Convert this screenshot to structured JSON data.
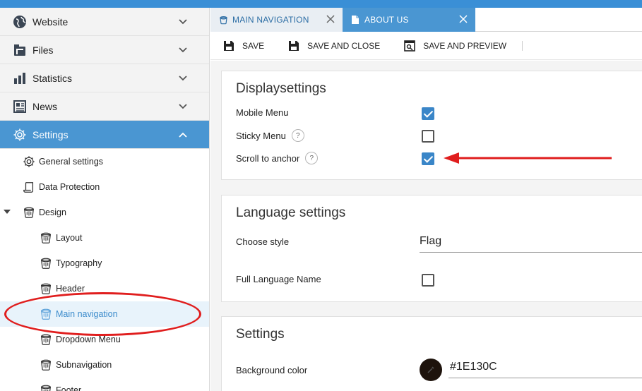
{
  "colors": {
    "accent": "#4a96d2",
    "topbar": "#3a8fd6",
    "checkbox_on": "#3a86c8",
    "annotation": "#e01e1e",
    "background_color_value": "#1e130c"
  },
  "sidebar": {
    "items": [
      {
        "label": "Website",
        "icon": "globe-icon"
      },
      {
        "label": "Files",
        "icon": "files-icon"
      },
      {
        "label": "Statistics",
        "icon": "bar-chart-icon"
      },
      {
        "label": "News",
        "icon": "newspaper-icon"
      },
      {
        "label": "Settings",
        "icon": "gear-icon"
      }
    ],
    "settings_children": [
      {
        "label": "General settings",
        "icon": "gear-icon"
      },
      {
        "label": "Data Protection",
        "icon": "scroll-icon"
      },
      {
        "label": "Design",
        "icon": "paint-bucket-icon"
      }
    ],
    "design_children": [
      {
        "label": "Layout",
        "icon": "paint-bucket-icon"
      },
      {
        "label": "Typography",
        "icon": "paint-bucket-icon"
      },
      {
        "label": "Header",
        "icon": "paint-bucket-icon"
      },
      {
        "label": "Main navigation",
        "icon": "paint-bucket-icon"
      },
      {
        "label": "Dropdown Menu",
        "icon": "paint-bucket-icon"
      },
      {
        "label": "Subnavigation",
        "icon": "paint-bucket-icon"
      },
      {
        "label": "Footer",
        "icon": "paint-bucket-icon"
      }
    ]
  },
  "tabs": [
    {
      "label": "MAIN NAVIGATION",
      "icon": "paint-bucket-icon"
    },
    {
      "label": "ABOUT US",
      "icon": "document-icon"
    }
  ],
  "toolbar": {
    "save_label": "SAVE",
    "save_close_label": "SAVE AND CLOSE",
    "save_preview_label": "SAVE AND PREVIEW"
  },
  "display_settings": {
    "title": "Displaysettings",
    "mobile_menu": {
      "label": "Mobile Menu",
      "checked": true
    },
    "sticky_menu": {
      "label": "Sticky Menu",
      "checked": false,
      "help": "?"
    },
    "scroll_to_anchor": {
      "label": "Scroll to anchor",
      "checked": true,
      "help": "?"
    }
  },
  "language_settings": {
    "title": "Language settings",
    "choose_style": {
      "label": "Choose style",
      "value": "Flag"
    },
    "full_language_name": {
      "label": "Full Language Name",
      "checked": false
    }
  },
  "settings": {
    "title": "Settings",
    "background_color": {
      "label": "Background color",
      "value": "#1E130C"
    }
  }
}
